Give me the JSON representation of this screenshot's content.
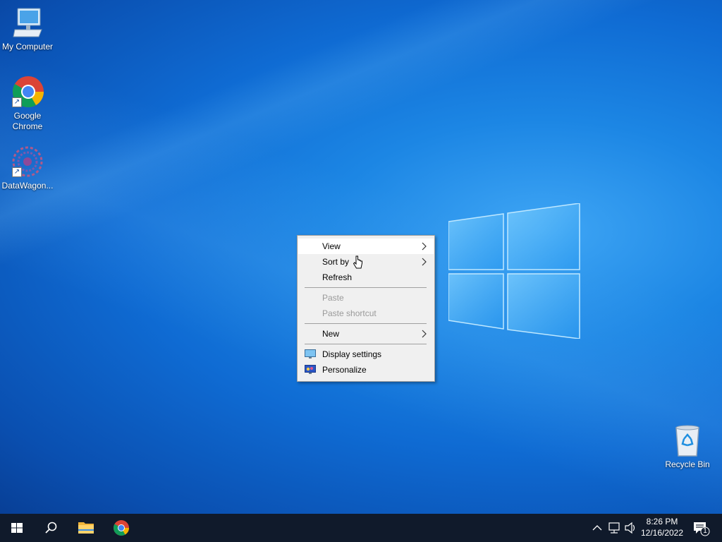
{
  "desktop_icons": [
    {
      "label": "My Computer"
    },
    {
      "label": "Google Chrome"
    },
    {
      "label": "DataWagon..."
    },
    {
      "label": "Recycle Bin"
    }
  ],
  "context_menu": {
    "view": "View",
    "sort_by": "Sort by",
    "refresh": "Refresh",
    "paste": "Paste",
    "paste_shortcut": "Paste shortcut",
    "new": "New",
    "display_settings": "Display settings",
    "personalize": "Personalize"
  },
  "taskbar": {
    "start_icon": "windows-start-icon",
    "search_icon": "search-icon",
    "apps": [
      "file-explorer-icon",
      "chrome-icon"
    ],
    "time": "8:26 PM",
    "date": "12/16/2022",
    "notification_count": "1"
  },
  "colors": {
    "taskbar": "#101a2b",
    "menu_bg": "#f0f0f0",
    "desktop_accent": "#1c86e4"
  }
}
